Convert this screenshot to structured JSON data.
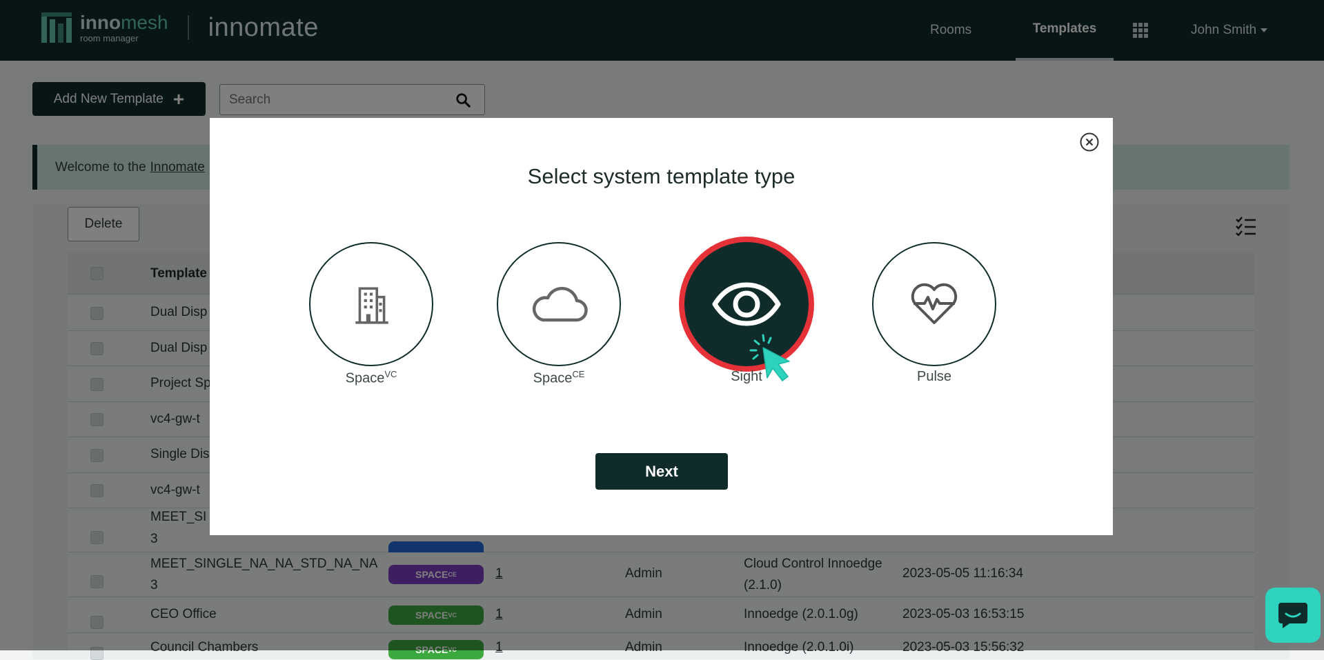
{
  "header": {
    "brand_prefix": "inno",
    "brand_suffix": "mesh",
    "brand_sub": "room manager",
    "product": "innomate",
    "nav": {
      "rooms": "Rooms",
      "templates": "Templates"
    },
    "user": "John Smith"
  },
  "toolbar": {
    "add_label": "Add New Template",
    "search_placeholder": "Search",
    "delete_label": "Delete"
  },
  "welcome": {
    "prefix": "Welcome to the",
    "link": "Innomate"
  },
  "table": {
    "header_template": "Template",
    "rows": [
      {
        "name": "Dual Disp"
      },
      {
        "name": "Dual Disp"
      },
      {
        "name": "Project Sp"
      },
      {
        "name": "vc4-gw-t"
      },
      {
        "name": "Single Dis"
      },
      {
        "name": "vc4-gw-t"
      },
      {
        "name_line1": "MEET_SI",
        "name_line2": "3"
      },
      {
        "name_line1": "MEET_SINGLE_NA_NA_STD_NA_NA",
        "name_line2": "3",
        "badge": "SPACE",
        "badge_sup": "CE",
        "count": "1",
        "owner": "Admin",
        "sys_line1": "Cloud Control Innoedge",
        "sys_line2": "(2.1.0)",
        "date": "2023-05-05 11:16:34"
      },
      {
        "name": "CEO Office",
        "badge": "SPACE",
        "badge_sup": "VC",
        "count": "1",
        "owner": "Admin",
        "sys": "Innoedge (2.0.1.0g)",
        "date": "2023-05-03 16:53:15"
      },
      {
        "name": "Council Chambers",
        "badge": "SPACE",
        "badge_sup": "VC",
        "count": "1",
        "owner": "Admin",
        "sys": "Innoedge (2.0.1.0i)",
        "date": "2023-05-03 15:56:32"
      }
    ]
  },
  "modal": {
    "title": "Select system template type",
    "options": [
      {
        "label": "Space",
        "sup": "VC",
        "icon": "building-icon"
      },
      {
        "label": "Space",
        "sup": "CE",
        "icon": "cloud-icon"
      },
      {
        "label": "Sight",
        "sup": "",
        "icon": "eye-icon",
        "selected": true
      },
      {
        "label": "Pulse",
        "sup": "",
        "icon": "heartbeat-icon"
      }
    ],
    "next_label": "Next"
  },
  "colors": {
    "brand_dark": "#0f2b2a",
    "accent": "#63c7b1",
    "selected_ring": "#e53239",
    "chat": "#2ed3bd"
  }
}
